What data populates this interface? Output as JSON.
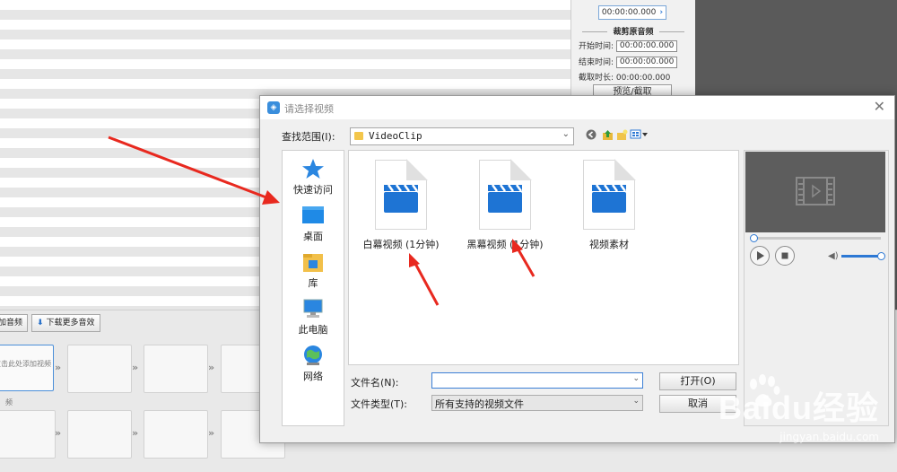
{
  "background_app": {
    "duration_row": "00:00:00.000",
    "crop_section_title": "裁剪原音频",
    "start_label": "开始时间:",
    "start_value": "00:00:00.000",
    "end_label": "结束时间:",
    "end_value": "00:00:00.000",
    "length_label": "截取时长:",
    "length_value": "00:00:00.000",
    "preview_button": "预览/截取",
    "toolbar_left_label": "加音频",
    "download_button": "下载更多音效",
    "first_clip_text": "双击此处添加视频",
    "track_label": "频"
  },
  "dialog": {
    "title": "请选择视频",
    "close_glyph": "✕",
    "look_in_label": "查找范围(I):",
    "look_in_value": "VideoClip",
    "places": [
      {
        "label": "快速访问",
        "icon": "star-icon"
      },
      {
        "label": "桌面",
        "icon": "desktop-icon"
      },
      {
        "label": "库",
        "icon": "library-icon"
      },
      {
        "label": "此电脑",
        "icon": "computer-icon"
      },
      {
        "label": "网络",
        "icon": "network-icon"
      }
    ],
    "files": [
      {
        "label": "白幕视频 (1分钟)"
      },
      {
        "label": "黑幕视频 (1分钟)"
      },
      {
        "label": "视频素材"
      }
    ],
    "file_name_label": "文件名(N):",
    "file_name_value": "",
    "file_type_label": "文件类型(T):",
    "file_type_value": "所有支持的视频文件",
    "open_button": "打开(O)",
    "cancel_button": "取消"
  },
  "watermark": {
    "brand": "Baidu经验",
    "url": "jingyan.baidu.com"
  },
  "colors": {
    "accent": "#2c78d4",
    "annotation_arrow": "#e8291f",
    "clapper": "#1e74d4"
  }
}
